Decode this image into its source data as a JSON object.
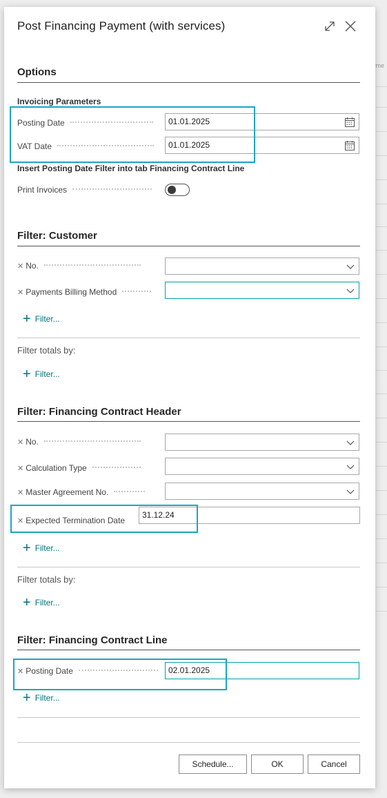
{
  "dialog": {
    "title": "Post Financing Payment (with services)"
  },
  "background": {
    "partial_text": "yme"
  },
  "options": {
    "section_title": "Options",
    "group_title": "Invoicing Parameters",
    "posting_date_label": "Posting Date",
    "posting_date_value": "01.01.2025",
    "vat_date_label": "VAT Date",
    "vat_date_value": "01.01.2025",
    "insert_filter_label": "Insert Posting Date Filter into tab Financing Contract Line",
    "print_invoices_label": "Print Invoices",
    "print_invoices_on": false
  },
  "customer": {
    "section_title": "Filter: Customer",
    "no_label": "No.",
    "no_value": "",
    "billing_method_label": "Payments Billing Method",
    "billing_method_value": "",
    "filter_link": "Filter...",
    "totals_label": "Filter totals by:",
    "totals_filter_link": "Filter..."
  },
  "contract_header": {
    "section_title": "Filter: Financing Contract Header",
    "no_label": "No.",
    "no_value": "",
    "calc_type_label": "Calculation Type",
    "calc_type_value": "",
    "master_agreement_label": "Master Agreement No.",
    "master_agreement_value": "",
    "termination_label": "Expected Termination Date",
    "termination_value": "31.12.24",
    "filter_link": "Filter...",
    "totals_label": "Filter totals by:",
    "totals_filter_link": "Filter..."
  },
  "contract_line": {
    "section_title": "Filter: Financing Contract Line",
    "posting_date_label": "Posting Date",
    "posting_date_value": "02.01.2025",
    "filter_link": "Filter..."
  },
  "footer": {
    "schedule_label": "Schedule...",
    "ok_label": "OK",
    "cancel_label": "Cancel"
  },
  "colors": {
    "accent": "#00a2ad",
    "link": "#00737a",
    "highlight": "#1aa6c1"
  }
}
